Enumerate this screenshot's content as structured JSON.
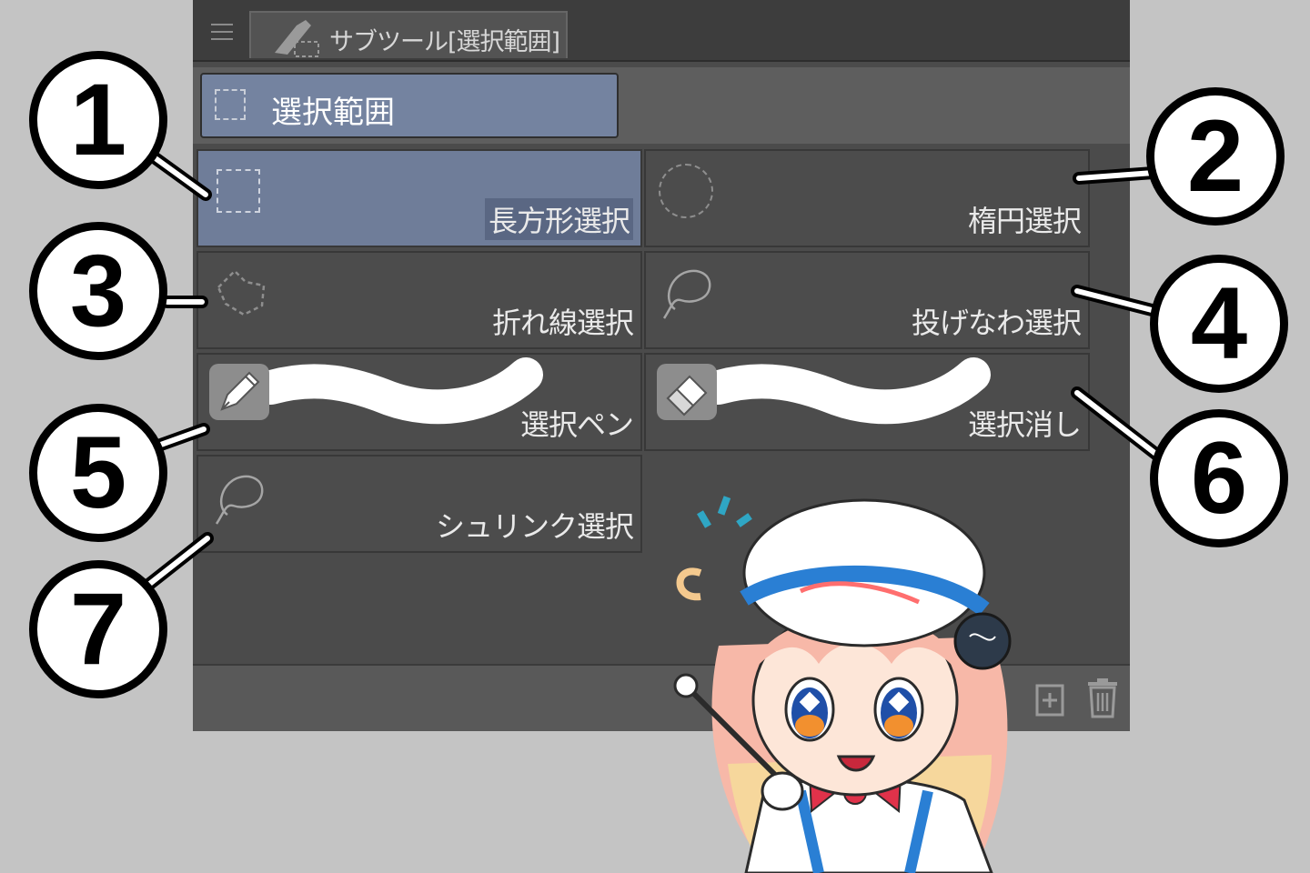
{
  "panel": {
    "tab_label": "サブツール[選択範囲]",
    "group_label": "選択範囲",
    "tools": [
      {
        "id": 1,
        "label": "長方形選択",
        "selected": true,
        "icon": "rectangle-select-icon"
      },
      {
        "id": 2,
        "label": "楕円選択",
        "selected": false,
        "icon": "ellipse-select-icon"
      },
      {
        "id": 3,
        "label": "折れ線選択",
        "selected": false,
        "icon": "polyline-select-icon"
      },
      {
        "id": 4,
        "label": "投げなわ選択",
        "selected": false,
        "icon": "lasso-select-icon"
      },
      {
        "id": 5,
        "label": "選択ペン",
        "selected": false,
        "icon": "selection-pen-icon"
      },
      {
        "id": 6,
        "label": "選択消し",
        "selected": false,
        "icon": "selection-eraser-icon"
      },
      {
        "id": 7,
        "label": "シュリンク選択",
        "selected": false,
        "icon": "shrink-select-icon"
      }
    ]
  },
  "callouts": [
    "1",
    "2",
    "3",
    "4",
    "5",
    "6",
    "7"
  ],
  "colors": {
    "selected_tool": "#6f7d99",
    "panel_bg": "#4b4b4b",
    "background": "#c4c4c4"
  }
}
